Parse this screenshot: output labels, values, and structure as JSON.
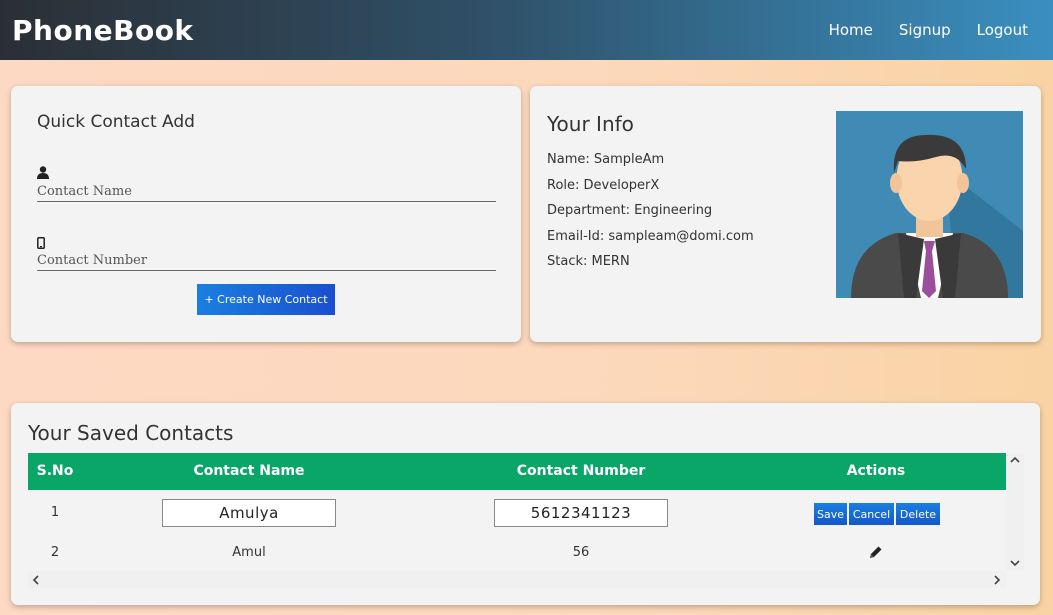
{
  "navbar": {
    "brand": "PhoneBook",
    "links": [
      "Home",
      "Signup",
      "Logout"
    ]
  },
  "quick_add": {
    "title": "Quick Contact Add",
    "name_placeholder": "Contact Name",
    "number_placeholder": "Contact Number",
    "create_button": "+ Create New Contact"
  },
  "your_info": {
    "title": "Your Info",
    "lines": [
      "Name: SampleAm",
      "Role: DeveloperX",
      "Department: Engineering",
      "Email-Id: sampleam@domi.com",
      "Stack: MERN"
    ],
    "avatar_icon": "user-avatar-icon"
  },
  "contacts": {
    "title": "Your Saved Contacts",
    "columns": [
      "S.No",
      "Contact Name",
      "Contact Number",
      "Actions"
    ],
    "editing_row": {
      "sno": "1",
      "name": "Amulya",
      "number": "5612341123",
      "actions": [
        "Save",
        "Cancel",
        "Delete"
      ]
    },
    "rows": [
      {
        "sno": "2",
        "name": "Amul",
        "number": "56",
        "action_icon": "pencil-icon"
      }
    ]
  },
  "colors": {
    "header_green": "#0aa667",
    "button_blue": "#1a7fe0"
  }
}
